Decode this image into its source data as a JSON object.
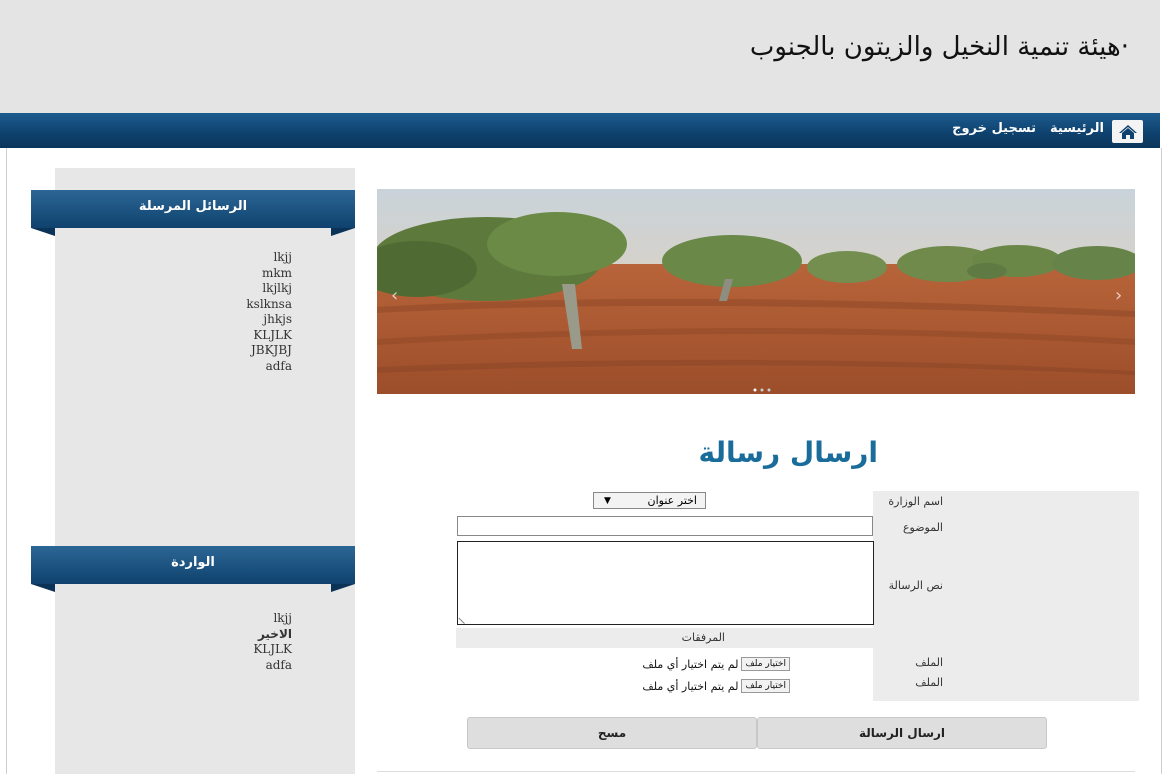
{
  "header": {
    "site_title": "·هيئة تنمية النخيل والزيتون بالجنوب"
  },
  "nav": {
    "home_icon": "home-icon",
    "home_label": "الرئيسية",
    "logout_label": "تسجيل خروج"
  },
  "sidebar": {
    "sent_title": "الرسائل المرسلة",
    "sent_items": [
      "lkjj",
      "mkm",
      "lkjlkj",
      "kslknsa",
      "jhkjs",
      "KLJLK",
      "JBKJBJ",
      "adfa"
    ],
    "inbox_title": "الواردة",
    "inbox_items": [
      "lkjj",
      "الاخير",
      "KLJLK",
      "adfa"
    ]
  },
  "slider": {
    "prev_icon": "chevron-left-icon",
    "next_icon": "chevron-right-icon"
  },
  "form": {
    "title": "ارسال رسالة",
    "ministry_label": "اسم الوزارة",
    "ministry_select_value": "اختر عنوان",
    "subject_label": "الموضوع",
    "subject_value": "",
    "body_label": "نص الرسالة",
    "body_value": "",
    "attachments_label": "المرفقات",
    "file_label_1": "الملف",
    "file_label_2": "الملف",
    "choose_file_label": "اختيار ملف",
    "no_file_text": "لم يتم اختيار أي ملف",
    "send_button": "ارسال الرسالة",
    "clear_button": "مسح"
  }
}
